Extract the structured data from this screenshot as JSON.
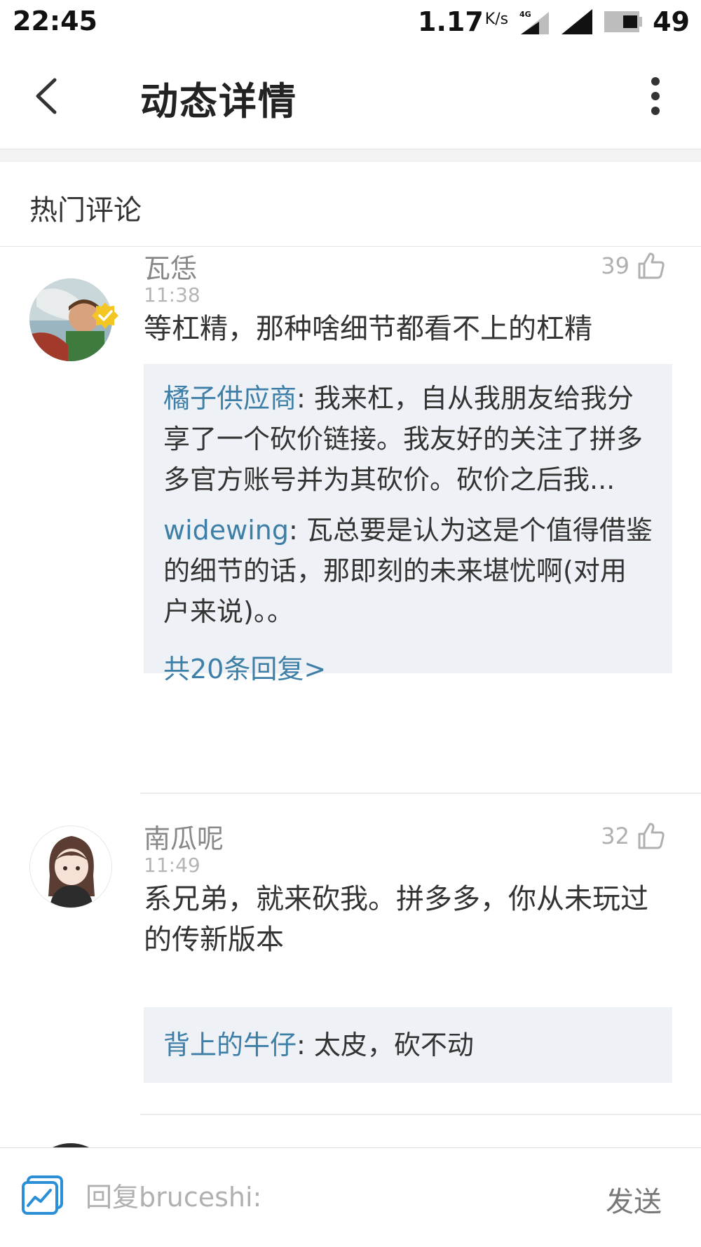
{
  "status_bar": {
    "time": "22:45",
    "speed": "1.17",
    "speed_unit": "K/s",
    "network": "4G",
    "battery": "49"
  },
  "header": {
    "title": "动态详情"
  },
  "section": {
    "title": "热门评论"
  },
  "comments": [
    {
      "name": "瓦恁",
      "time": "11:38",
      "likes": "39",
      "text": "等杠精，那种啥细节都看不上的杠精",
      "verified": true,
      "replies": [
        {
          "name": "橘子供应商",
          "sep": ": ",
          "text": "我来杠，自从我朋友给我分享了一个砍价链接。我友好的关注了拼多多官方账号并为其砍价。砍价之后我..."
        },
        {
          "name": "widewing",
          "sep": ": ",
          "text": "瓦总要是认为这是个值得借鉴的细节的话，那即刻的未来堪忧啊(对用户来说)。。"
        }
      ],
      "more_replies": "共20条回复>"
    },
    {
      "name": "南瓜呢",
      "time": "11:49",
      "likes": "32",
      "text": "系兄弟，就来砍我。拼多多，你从未玩过的传新版本",
      "verified": false,
      "replies": [
        {
          "name": "背上的牛仔",
          "sep": ": ",
          "text": "太皮，砍不动"
        }
      ]
    }
  ],
  "input": {
    "placeholder": "回复bruceshi:",
    "send_label": "发送"
  },
  "colors": {
    "link": "#3e7fa8",
    "reply_bg": "#eef1f5",
    "icon_blue": "#2a8fd6",
    "verified_yellow": "#f3c623"
  }
}
